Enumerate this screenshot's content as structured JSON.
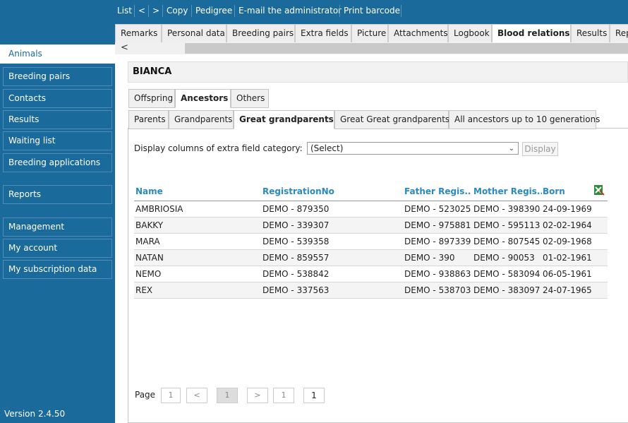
{
  "toolbar": {
    "list": "List",
    "prev": "<",
    "next": ">",
    "copy": "Copy",
    "pedigree": "Pedigree",
    "email": "E-mail the administrator",
    "print": "Print barcode"
  },
  "tabs": [
    "Remarks",
    "Personal data",
    "Breeding pairs",
    "Extra fields",
    "Picture",
    "Attachments",
    "Logbook",
    "Blood relations",
    "Results",
    "Rep"
  ],
  "sidebar": {
    "items": [
      "Animals",
      "Breeding pairs",
      "Contacts",
      "Results",
      "Waiting list",
      "Breeding applications",
      "Reports",
      "Management",
      "My account",
      "My subscription data"
    ],
    "version": "Version 2.4.50"
  },
  "scroll": {
    "left_arrow": "<"
  },
  "animal": {
    "name": "BIANCA"
  },
  "relation_tabs": [
    "Offspring",
    "Ancestors",
    "Others"
  ],
  "generation_tabs": [
    "Parents",
    "Grandparents",
    "Great grandparents",
    "Great Great grandparents",
    "All ancestors up to 10 generations"
  ],
  "extra_fields": {
    "label": "Display columns of extra field category:",
    "selected": "(Select)",
    "display_button": "Display"
  },
  "table": {
    "columns": [
      "Name",
      "RegistrationNo",
      "Father Regis...",
      "Mother Regis...",
      "Born"
    ],
    "rows": [
      [
        "AMBRIOSIA",
        "DEMO - 879350",
        "DEMO - 523025",
        "DEMO - 398390",
        "24-09-1969"
      ],
      [
        "BAKKY",
        "DEMO - 339307",
        "DEMO - 975881",
        "DEMO - 595113",
        "02-02-1964"
      ],
      [
        "MARA",
        "DEMO - 539358",
        "DEMO - 897339",
        "DEMO - 807545",
        "02-09-1968"
      ],
      [
        "NATAN",
        "DEMO - 859557",
        "DEMO - 390",
        "DEMO - 90053",
        "01-02-1961"
      ],
      [
        "NEMO",
        "DEMO - 538842",
        "DEMO - 938863",
        "DEMO - 583094",
        "06-05-1961"
      ],
      [
        "REX",
        "DEMO - 337563",
        "DEMO - 538703",
        "DEMO - 383097",
        "24-07-1965"
      ]
    ]
  },
  "pager": {
    "label": "Page",
    "first": "1",
    "prev": "<",
    "current": "1",
    "next": ">",
    "last": "1",
    "input": "1"
  }
}
